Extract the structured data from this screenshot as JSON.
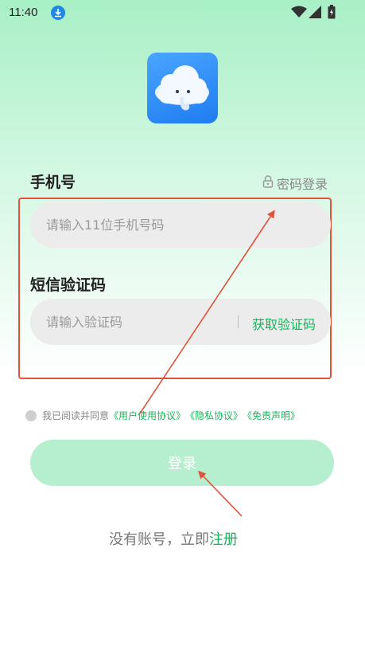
{
  "status_bar": {
    "time": "11:40",
    "icons": [
      "download-icon",
      "wifi-icon",
      "signal-icon",
      "battery-icon"
    ]
  },
  "app": {
    "logo_icon": "cloud-elephant-icon"
  },
  "form": {
    "phone_label": "手机号",
    "password_login_label": "密码登录",
    "phone_placeholder": "请输入11位手机号码",
    "code_label": "短信验证码",
    "code_placeholder": "请输入验证码",
    "get_code_label": "获取验证码"
  },
  "agreement": {
    "prefix": "我已阅读并同意",
    "links": [
      "《用户使用协议》",
      "《隐私协议》",
      "《免责声明》"
    ]
  },
  "login_button": "登录",
  "register": {
    "prefix": "没有账号，立即",
    "link": "注册"
  },
  "colors": {
    "accent_green": "#14b65a",
    "annotation_red": "#e0533a",
    "logo_blue": "#1f7cf0"
  }
}
